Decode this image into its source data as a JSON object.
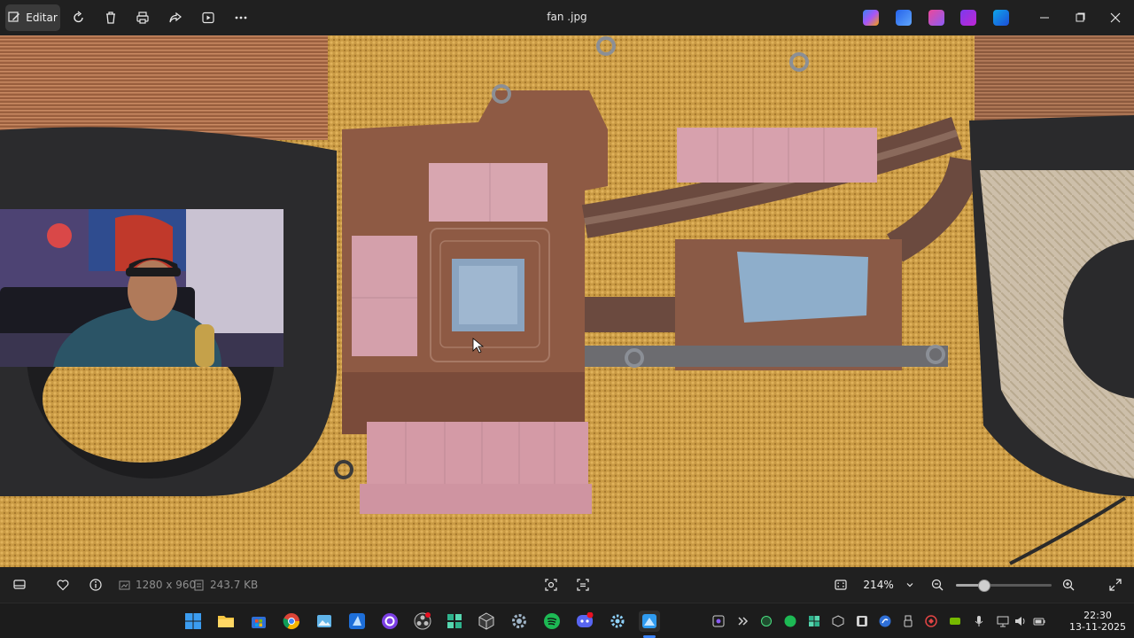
{
  "app": {
    "title": "fan .jpg",
    "edit_label": "Editar"
  },
  "toolbar": {
    "icons": [
      "rotate-icon",
      "delete-icon",
      "print-icon",
      "share-icon",
      "slideshow-icon",
      "more-icon"
    ]
  },
  "image_info": {
    "dimensions": "1280 x 960",
    "size": "243.7 KB"
  },
  "zoom": {
    "level": "214%",
    "slider_fraction": 0.29
  },
  "clock": {
    "time": "22:30",
    "date": "13-11-2025"
  },
  "colors": {
    "accent": "#3b82f6",
    "bar": "#202020",
    "taskbar": "#1c1c1c"
  }
}
